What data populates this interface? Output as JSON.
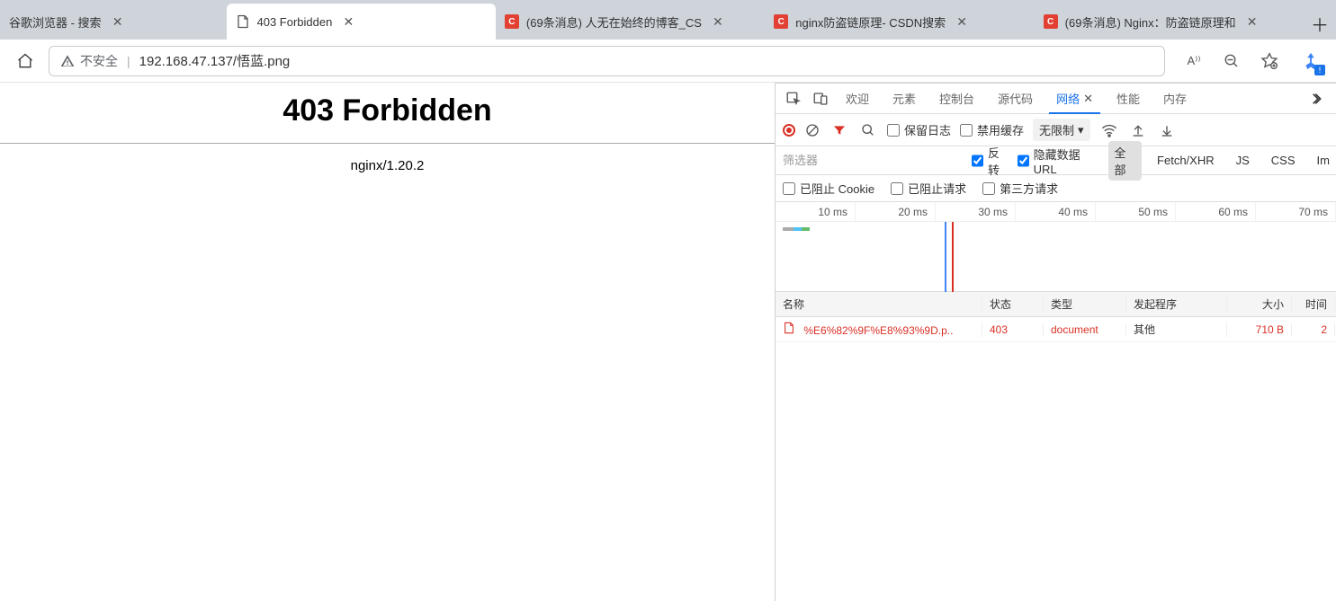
{
  "tabs": [
    {
      "title": "谷歌浏览器 - 搜索",
      "favicon": "none"
    },
    {
      "title": "403 Forbidden",
      "favicon": "page"
    },
    {
      "title": "(69条消息) 人无在始终的博客_CS",
      "favicon": "csdn"
    },
    {
      "title": "nginx防盗链原理- CSDN搜索",
      "favicon": "csdn"
    },
    {
      "title": "(69条消息) Nginx：防盗链原理和",
      "favicon": "csdn"
    }
  ],
  "csdn_glyph": "C",
  "address": {
    "insecure_label": "不安全",
    "url": "192.168.47.137/悟蓝.png",
    "readaloud_glyph": "A⁾⁾"
  },
  "page": {
    "error_title": "403 Forbidden",
    "server": "nginx/1.20.2"
  },
  "devtools": {
    "tabs": {
      "welcome": "欢迎",
      "elements": "元素",
      "console": "控制台",
      "sources": "源代码",
      "network": "网络",
      "performance": "性能",
      "memory": "内存"
    },
    "toolbar": {
      "preserve_log": "保留日志",
      "disable_cache": "禁用缓存",
      "throttling": "无限制"
    },
    "filter": {
      "placeholder": "筛选器",
      "invert": "反转",
      "hide_data_urls": "隐藏数据 URL",
      "types": {
        "all": "全部",
        "fetch": "Fetch/XHR",
        "js": "JS",
        "css": "CSS",
        "im": "Im"
      }
    },
    "filter2": {
      "blocked_cookies": "已阻止 Cookie",
      "blocked_requests": "已阻止请求",
      "third_party": "第三方请求"
    },
    "timeline_ticks": [
      "10 ms",
      "20 ms",
      "30 ms",
      "40 ms",
      "50 ms",
      "60 ms",
      "70 ms"
    ],
    "net_headers": {
      "name": "名称",
      "status": "状态",
      "type": "类型",
      "initiator": "发起程序",
      "size": "大小",
      "time": "时间"
    },
    "requests": [
      {
        "name": "%E6%82%9F%E8%93%9D.p..",
        "status": "403",
        "type": "document",
        "initiator": "其他",
        "size": "710 B",
        "time": "2"
      }
    ]
  }
}
